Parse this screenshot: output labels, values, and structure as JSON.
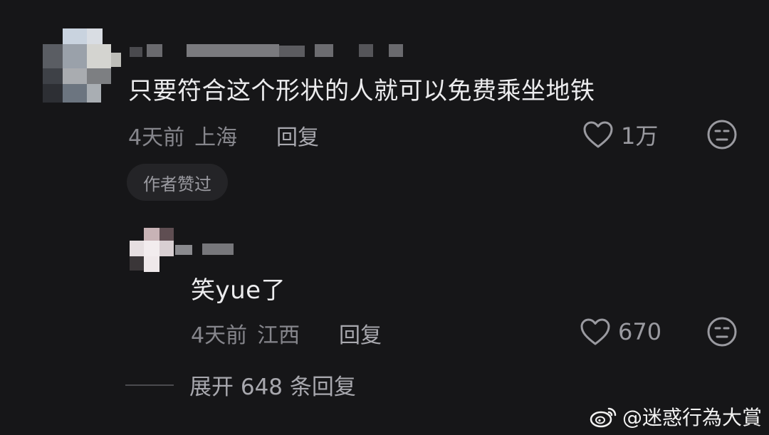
{
  "comments": [
    {
      "text": "只要符合这个形状的人就可以免费乘坐地铁",
      "time": "4天前",
      "location": "上海",
      "reply_label": "回复",
      "likes": "1万",
      "author_liked_label": "作者赞过"
    },
    {
      "text": "笑yue了",
      "time": "4天前",
      "location": "江西",
      "reply_label": "回复",
      "likes": "670"
    }
  ],
  "expand_label": "展开 648 条回复",
  "watermark": "@迷惑行為大賞",
  "icons": {
    "like": "heart-outline-icon",
    "dislike": "neutral-face-icon",
    "watermark_logo": "weibo-icon"
  }
}
